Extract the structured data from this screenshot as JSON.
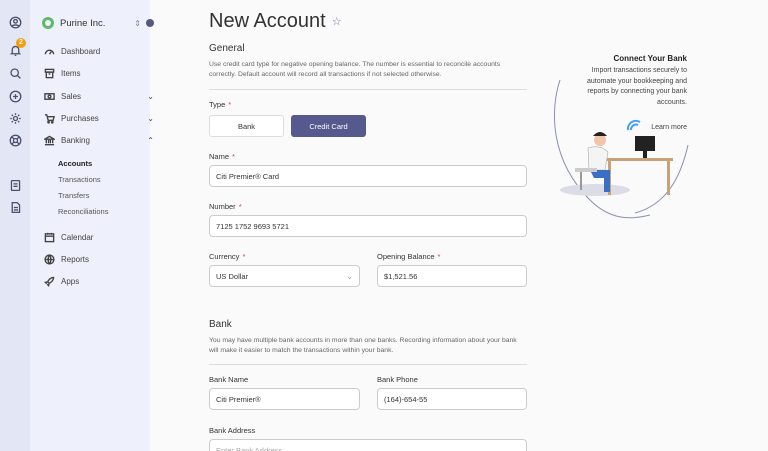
{
  "company": {
    "name": "Purine Inc.",
    "switch_icon": "unfold-icon"
  },
  "rail": {
    "notification_count": "2"
  },
  "nav": {
    "dashboard": "Dashboard",
    "items": "Items",
    "sales": "Sales",
    "purchases": "Purchases",
    "banking": "Banking",
    "banking_sub": [
      "Accounts",
      "Transactions",
      "Transfers",
      "Reconciliations"
    ],
    "calendar": "Calendar",
    "reports": "Reports",
    "apps": "Apps"
  },
  "page": {
    "title": "New Account"
  },
  "general": {
    "title": "General",
    "description": "Use credit card type for negative opening balance. The number is essential to reconcile accounts correctly. Default account will record all transactions if not selected otherwise.",
    "type_label": "Type",
    "type_options": [
      "Bank",
      "Credit Card"
    ],
    "type_selected": "Credit Card",
    "name_label": "Name",
    "name_value": "Citi Premier® Card",
    "number_label": "Number",
    "number_value": "7125 1752 9693 5721",
    "currency_label": "Currency",
    "currency_value": "US Dollar",
    "opening_balance_label": "Opening Balance",
    "opening_balance_value": "$1,521.56"
  },
  "bank": {
    "title": "Bank",
    "description": "You may have multiple bank accounts in more than one banks. Recording information about your bank will make it easier to match the transactions within your bank.",
    "bank_name_label": "Bank Name",
    "bank_name_value": "Citi Premier®",
    "bank_phone_label": "Bank Phone",
    "bank_phone_value": "(164)-654-55",
    "bank_address_label": "Bank Address",
    "bank_address_placeholder": "Enter Bank Address"
  },
  "promo": {
    "title": "Connect Your Bank",
    "text": "Import transactions securely to automate your bookkeeping and reports by connecting your bank accounts.",
    "link": "Learn more"
  },
  "colors": {
    "accent": "#55598e",
    "sidebar_bg": "#eef0fb",
    "rail_bg": "#e3e6f5",
    "required": "#e53935"
  }
}
